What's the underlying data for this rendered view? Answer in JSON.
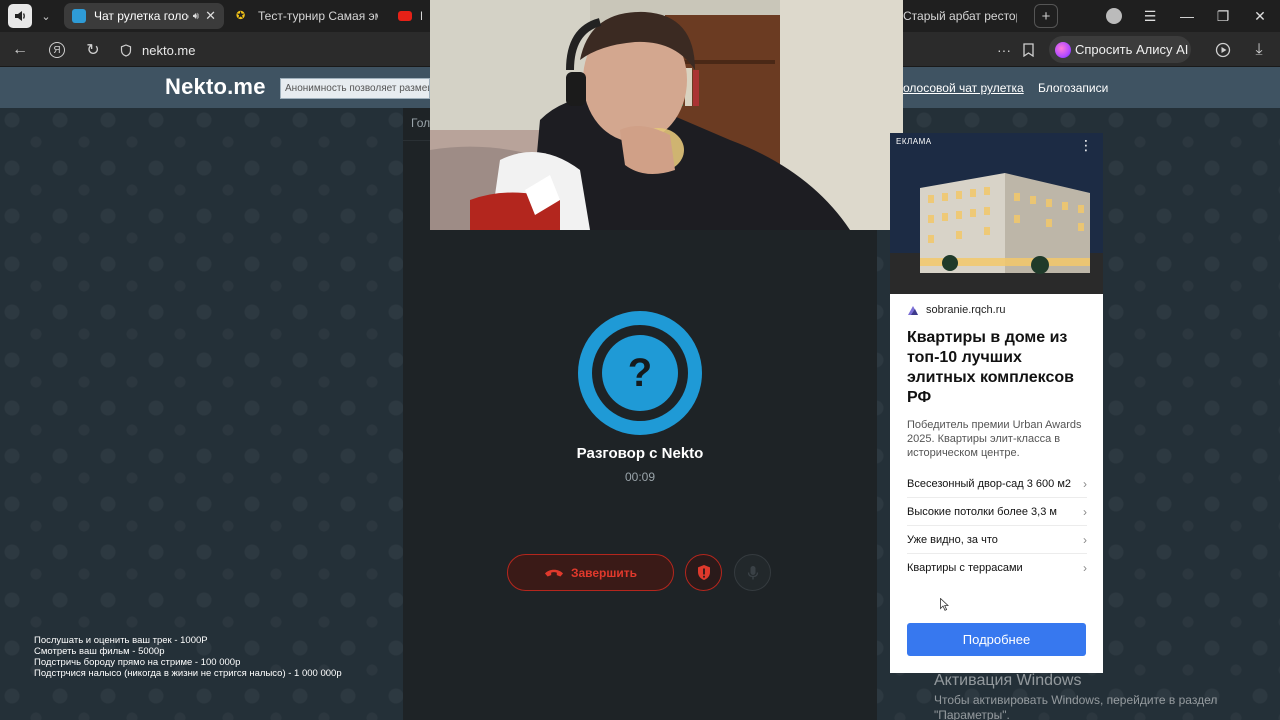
{
  "browser": {
    "tabs": [
      {
        "title": "Чат рулетка голосо",
        "active": true
      },
      {
        "title": "Тест-турнир Самая эмо",
        "active": false
      },
      {
        "title": "По",
        "active": false
      }
    ],
    "far_tab_title": "Старый арбат ресторан",
    "url": "nekto.me",
    "alice_label": "Спросить Алису AI"
  },
  "site": {
    "logo": "Nekto.me",
    "anon_text": "Анонимность позволяет размеща",
    "nav_links": [
      "олосовой чат рулетка",
      "Блогозаписи"
    ]
  },
  "chat": {
    "tab_label": "Гол",
    "title": "Разговор с Nekto",
    "timer": "00:09",
    "end_label": "Завершить"
  },
  "ad": {
    "label": "ЕКЛАМА",
    "domain": "sobranie.rqch.ru",
    "headline": "Квартиры в доме из топ-10 лучших элитных комплексов РФ",
    "description": "Победитель премии Urban Awards 2025. Квартиры элит-класса в историческом центре.",
    "features": [
      "Всесезонный двор-сад 3 600 м2",
      "Высокие потолки более 3,3 м",
      "Уже видно, за что",
      "Квартиры с террасами"
    ],
    "cta": "Подробнее"
  },
  "stream_prices": [
    "Послушать и оценить ваш трек - 1000Р",
    "Смотреть ваш фильм - 5000р",
    "Подстричь бороду прямо на стриме - 100 000р",
    "Подстрчися налысо (никогда в жизни не стригся налысо) - 1 000 000р"
  ],
  "windows_activation": {
    "title": "Активация Windows",
    "text": "Чтобы активировать Windows, перейдите в раздел \"Параметры\"."
  },
  "colors": {
    "accent_blue": "#1f9ad6",
    "end_red": "#e0392c",
    "header": "#3f5362",
    "cta_blue": "#3778ef"
  }
}
